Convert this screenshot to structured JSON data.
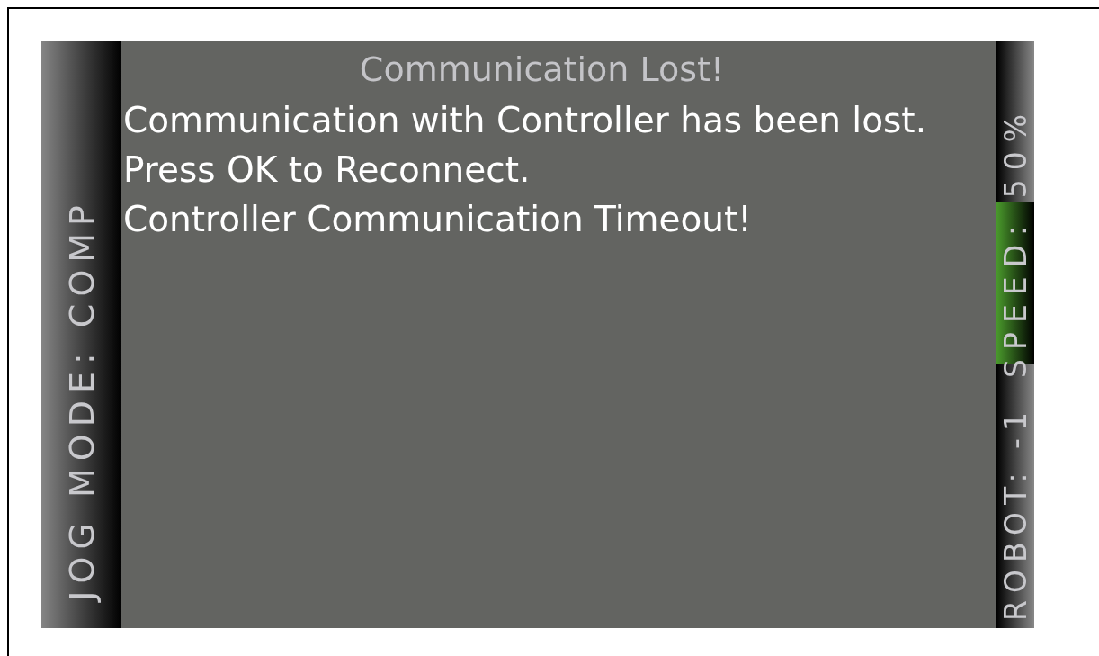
{
  "left_bar": {
    "jog_mode": "JOG MODE: COMP"
  },
  "dialog": {
    "title": "Communication Lost!",
    "lines": [
      "Communication with Controller has been lost.",
      "Press OK to Reconnect.",
      "Controller Communication Timeout!"
    ]
  },
  "right_bar": {
    "robot": "ROBOT: -1",
    "speed": "SPEED: 50%",
    "speed_highlighted": true
  }
}
